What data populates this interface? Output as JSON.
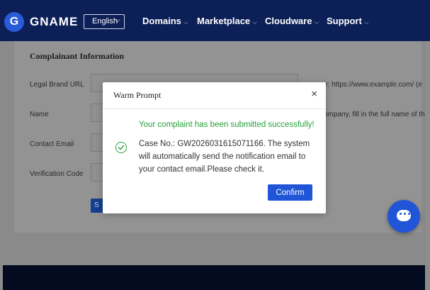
{
  "header": {
    "logo_letter": "G",
    "logo_text": "GNAME",
    "language": "English",
    "nav": [
      {
        "label": "Domains"
      },
      {
        "label": "Marketplace"
      },
      {
        "label": "Cloudware"
      },
      {
        "label": "Support"
      }
    ]
  },
  "form": {
    "section_title": "Complainant Information",
    "fields": [
      {
        "label": "Legal Brand URL",
        "hint": "e: https://www.example.com/  (e"
      },
      {
        "label": "Name",
        "hint": "ompany, fill in the full name of th"
      },
      {
        "label": "Contact Email"
      },
      {
        "label": "Verification Code"
      }
    ],
    "submit_initial": "S"
  },
  "modal": {
    "title": "Warm Prompt",
    "close": "×",
    "success_title": "Your complaint has been submitted successfully!",
    "message": "Case No.: GW2026031615071166. The system will automatically send the notification email to your contact email.Please check it.",
    "confirm_label": "Confirm"
  },
  "colors": {
    "header_bg": "#0c1f57",
    "accent": "#1f55d6",
    "success": "#25a13a"
  },
  "icons": {
    "logo": "logo-icon",
    "success": "check-circle-icon",
    "chat": "chat-icon",
    "close": "close-icon",
    "dropdown": "chevron-down-icon"
  }
}
